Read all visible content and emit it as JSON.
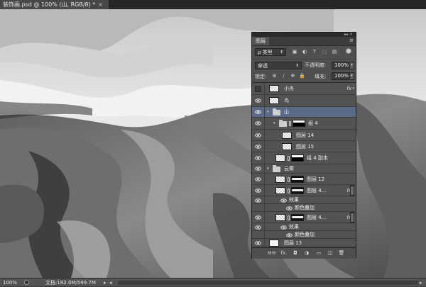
{
  "document": {
    "tab_title": "装饰画.psd @ 100% (山, RGB/8) *",
    "close_glyph": "×"
  },
  "status_bar": {
    "zoom": "100%",
    "doc_size": "文档:182.0M/599.7M",
    "menu_arrow": "▸",
    "scroll_left": "◂",
    "scroll_right": "▸"
  },
  "layers_panel": {
    "tab_label": "图层",
    "window_controls": "◂◂ ×",
    "menu_glyph": "≡",
    "filter": {
      "kind_label": "ρ 类型",
      "caret": "⬍",
      "icons": [
        "image-filter-icon",
        "adjustment-filter-icon",
        "type-filter-icon",
        "shape-filter-icon",
        "smart-object-filter-icon"
      ],
      "icon_glyphs": [
        "▣",
        "◐",
        "T",
        "⬚",
        "▤"
      ]
    },
    "blend": {
      "mode": "穿透",
      "caret": "⬍",
      "opacity_label": "不透明度:",
      "opacity_value": "100%"
    },
    "lock": {
      "lock_label": "锁定:",
      "lock_glyphs": [
        "⊞",
        "∕",
        "✥",
        "🔒"
      ],
      "fill_label": "填充:",
      "fill_value": "100%"
    },
    "stepper_arrow": "▾",
    "layers": [
      {
        "name": "小舟",
        "visible": false,
        "fx": "fx",
        "fx_arrow": "▾"
      },
      {
        "name": "鸟",
        "visible": true
      },
      {
        "name": "山",
        "visible": true,
        "selected": true,
        "expand": "▾"
      },
      {
        "name": "组 4",
        "visible": true,
        "expand": "▾"
      },
      {
        "name": "图层 14",
        "visible": true
      },
      {
        "name": "图层 15",
        "visible": true
      },
      {
        "name": "组 4 副本",
        "visible": true
      },
      {
        "name": "云雾",
        "visible": true,
        "expand": "▾"
      },
      {
        "name": "图层 12",
        "visible": true
      },
      {
        "name": "图层 4...",
        "visible": true,
        "fx": "fx",
        "fx_arrow": "▾"
      },
      {
        "name": "效果",
        "visible": true
      },
      {
        "name": "颜色叠加",
        "visible": true
      },
      {
        "name": "图层 4...",
        "visible": true,
        "fx": "fx",
        "fx_arrow": "▾"
      },
      {
        "name": "效果",
        "visible": true
      },
      {
        "name": "颜色叠加",
        "visible": true
      },
      {
        "name": "图层 13",
        "visible": true
      }
    ],
    "footer": {
      "icons": [
        "link-icon",
        "fx-icon",
        "mask-icon",
        "adjustment-icon",
        "new-group-icon",
        "new-layer-icon",
        "trash-icon"
      ],
      "glyphs": [
        "⊖⊖",
        "fx.",
        "◘",
        "◑",
        "▭",
        "◫",
        "🗑"
      ]
    }
  },
  "colors": {
    "selection": "#5a6a88",
    "panel": "#4f4f4f",
    "dark_chrome": "#262626"
  }
}
